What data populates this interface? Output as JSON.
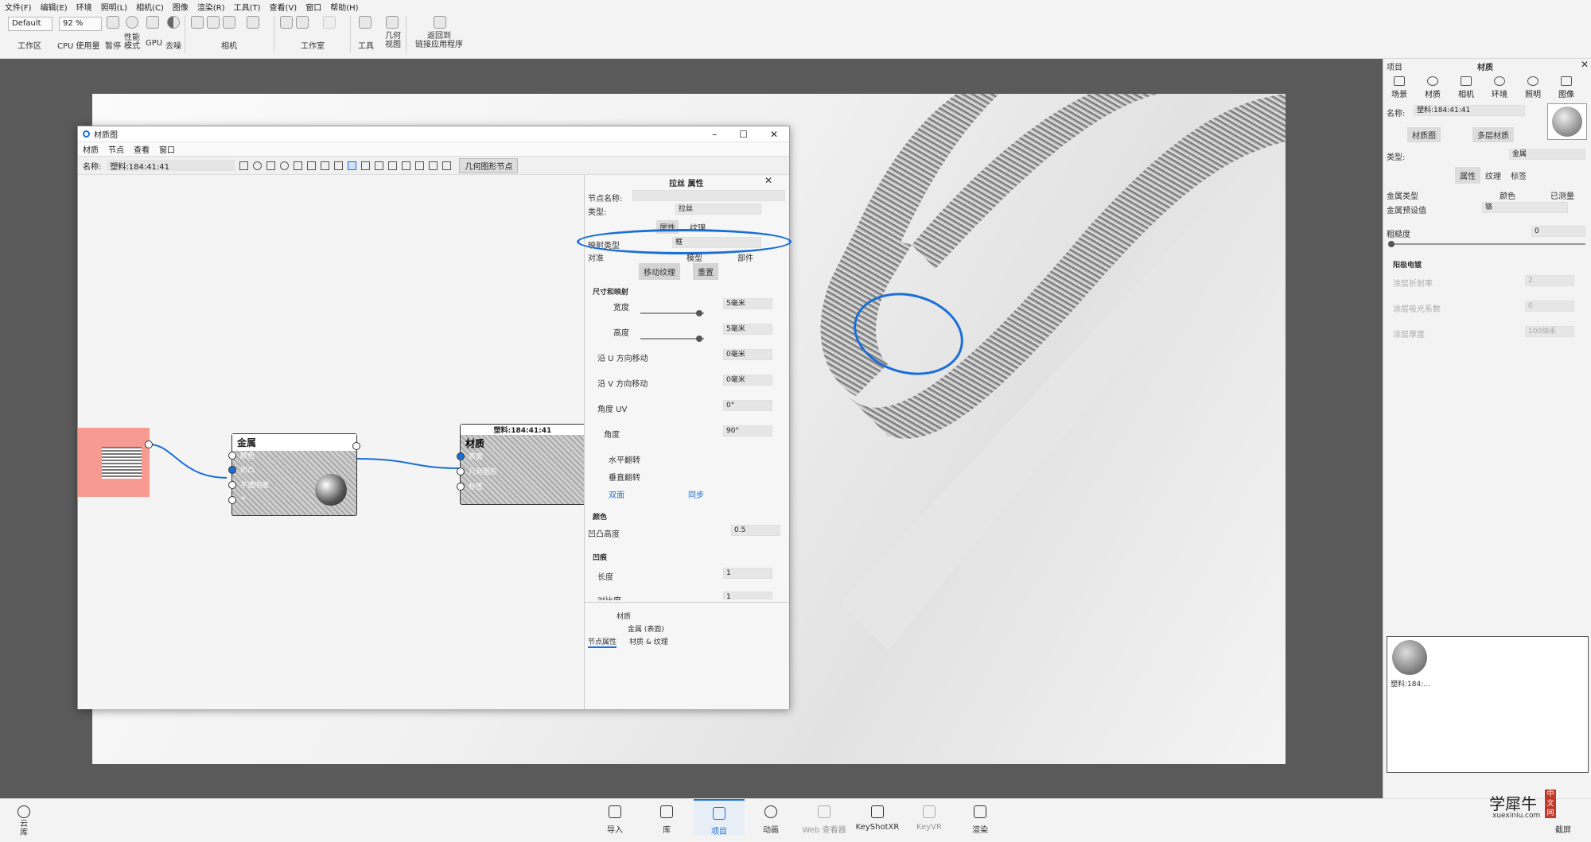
{
  "menu": [
    "文件(F)",
    "编辑(E)",
    "环境",
    "照明(L)",
    "相机(C)",
    "图像",
    "渲染(R)",
    "工具(T)",
    "查看(V)",
    "窗口",
    "帮助(H)"
  ],
  "toolbar": {
    "workspace_value": "Default",
    "zoom_value": "92 %",
    "labels": {
      "workspace": "工作区",
      "cpu": "CPU 使用量",
      "pause": "暂停",
      "perf": "性能\n模式",
      "gpu": "GPU",
      "denoise": "去噪",
      "camera": "相机",
      "studio": "工作室",
      "tools": "工具",
      "geom": "几何\n视图",
      "back": "返回到\n链接应用程序"
    }
  },
  "material_window": {
    "title": "材质图",
    "menu": [
      "材质",
      "节点",
      "查看",
      "窗口"
    ],
    "name_label": "名称:",
    "name_value": "塑料:184:41:41",
    "geometry_node_btn": "几何图形节点",
    "nodes": {
      "metal": {
        "title": "金属",
        "ports": [
          "颜色",
          "凹凸",
          "不透明度",
          "+"
        ]
      },
      "material": {
        "header": "塑料:184:41:41",
        "title": "材质",
        "ports": [
          "表面",
          "几何图形",
          "标签"
        ]
      }
    },
    "props": {
      "title": "拉丝 属性",
      "node_name_label": "节点名称:",
      "type_label": "类型:",
      "type_value": "拉丝",
      "tabs": [
        "属性",
        "纹理"
      ],
      "mapping_label": "映射类型",
      "mapping_value": "框",
      "align_label": "对准",
      "align_opts": [
        "模型",
        "部件"
      ],
      "move_tex": "移动纹理",
      "reset": "重置",
      "size_section": "尺寸和映射",
      "width_label": "宽度",
      "width_value": "5毫米",
      "height_label": "高度",
      "height_value": "5毫米",
      "u_label": "沿 U 方向移动",
      "u_value": "0毫米",
      "v_label": "沿 V 方向移动",
      "v_value": "0毫米",
      "uv_label": "角度 UV",
      "uv_value": "0°",
      "angle_label": "角度",
      "angle_value": "90°",
      "hflip": "水平翻转",
      "vflip": "垂直翻转",
      "double": "双面",
      "sync": "同步",
      "color_section": "颜色",
      "bump_label": "凹凸高度",
      "bump_value": "0.5",
      "scratch_section": "凹痕",
      "length_label": "长度",
      "length_value": "1",
      "width2_label": "对比度",
      "width2_value": "1",
      "tree": [
        "材质",
        "金属 (表面)"
      ],
      "bottom_tabs": [
        "节点属性",
        "材质 & 纹理"
      ]
    }
  },
  "right_panel": {
    "project": "项目",
    "section": "材质",
    "tabs": [
      "场景",
      "材质",
      "相机",
      "环境",
      "照明",
      "图像"
    ],
    "name_label": "名称:",
    "name_value": "塑料:184:41:41",
    "mat_graph_btn": "材质图",
    "multi_btn": "多层材质",
    "type_label": "类型:",
    "type_value": "金属",
    "sub_tabs": [
      "属性",
      "纹理",
      "标签"
    ],
    "metal_type_label": "金属类型",
    "metal_opts": [
      "颜色",
      "已测量"
    ],
    "preset_label": "金属预设值",
    "preset_value": "铬",
    "rough_label": "粗糙度",
    "rough_value": "0",
    "anod_label": "阳极电镀",
    "coat_ior": "涂层折射率",
    "coat_ior_v": "2",
    "coat_abs": "涂层吸光系数",
    "coat_abs_v": "0",
    "coat_th": "涂层厚度",
    "coat_th_v": "100纳米",
    "thumb_label": "塑料:184:..."
  },
  "bottom": {
    "cloud": "云\n库",
    "items": [
      "导入",
      "库",
      "项目",
      "动画",
      "Web 查看器",
      "KeyShotXR",
      "KeyVR",
      "渲染"
    ],
    "screenshot": "截屏",
    "watermark": "学犀牛",
    "watermark_url": "xuexiniu.com",
    "watermark_badge": "中文网"
  }
}
